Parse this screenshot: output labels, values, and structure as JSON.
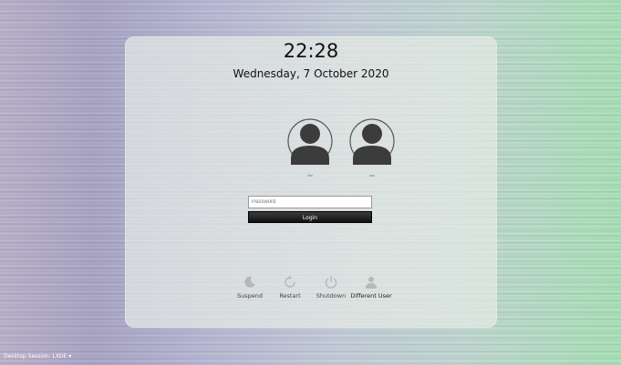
{
  "clock": {
    "time": "22:28",
    "date": "Wednesday, 7 October 2020"
  },
  "users": [
    {
      "icon": "user-avatar-icon"
    },
    {
      "icon": "user-avatar-icon"
    }
  ],
  "login": {
    "password_placeholder": "Password",
    "button_label": "Login"
  },
  "actions": [
    {
      "label": "Suspend",
      "icon": "suspend-icon"
    },
    {
      "label": "Restart",
      "icon": "restart-icon"
    },
    {
      "label": "Shutdown",
      "icon": "shutdown-icon"
    },
    {
      "label": "Different User",
      "icon": "different-user-icon"
    }
  ],
  "session": {
    "label": "Desktop Session: LXDE"
  },
  "colors": {
    "panel": "#e4eae4",
    "login_button": "#1a1a1a"
  }
}
